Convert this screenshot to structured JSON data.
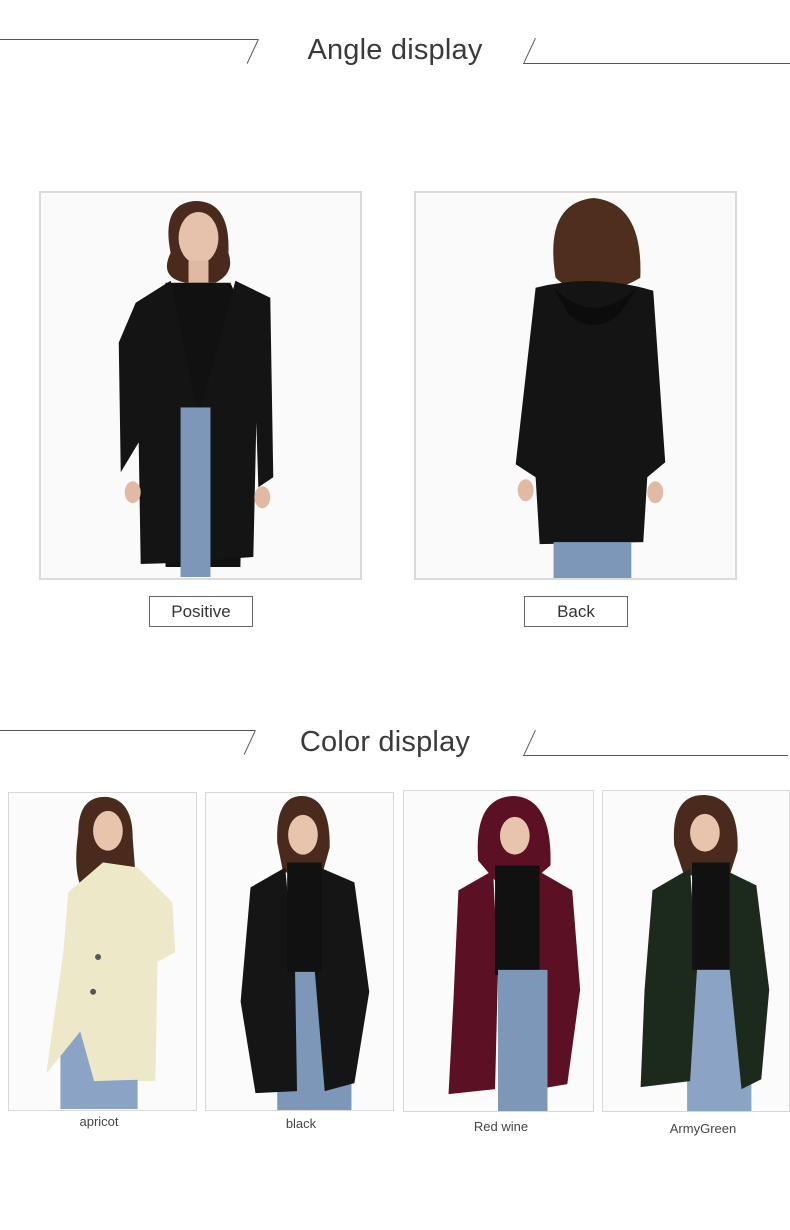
{
  "angle_section": {
    "title": "Angle display",
    "views": [
      {
        "label": "Positive",
        "coat_color": "#141414"
      },
      {
        "label": "Back",
        "coat_color": "#141414"
      }
    ]
  },
  "color_section": {
    "title": "Color display",
    "colors": [
      {
        "label": "apricot",
        "coat_color": "#ece8c8"
      },
      {
        "label": "black",
        "coat_color": "#151515"
      },
      {
        "label": "Red wine",
        "coat_color": "#5c1024"
      },
      {
        "label": "ArmyGreen",
        "coat_color": "#1c2a1c"
      }
    ]
  }
}
